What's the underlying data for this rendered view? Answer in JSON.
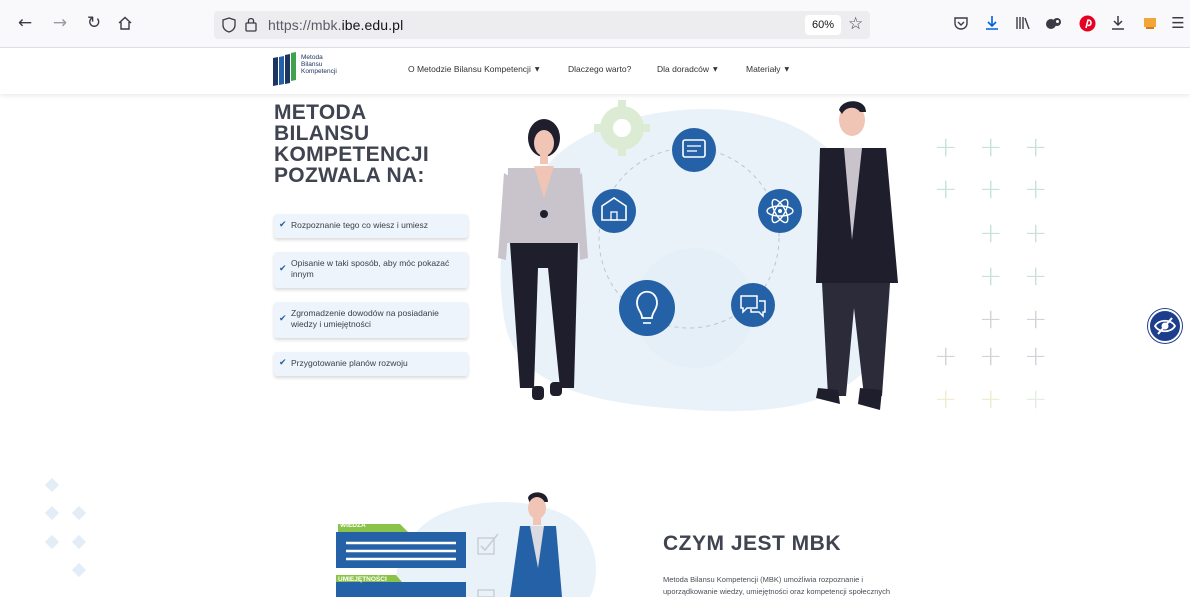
{
  "browser": {
    "url_prefix": "https://mbk.",
    "url_domain": "ibe.edu.pl",
    "zoom": "60%"
  },
  "site": {
    "logo_lines": [
      "Metoda",
      "Bilansu",
      "Kompetencji"
    ],
    "menu": [
      {
        "label": "O Metodzie Bilansu Kompetencji",
        "has_dropdown": true
      },
      {
        "label": "Dlaczego warto?",
        "has_dropdown": false
      },
      {
        "label": "Dla doradców",
        "has_dropdown": true
      },
      {
        "label": "Materiały",
        "has_dropdown": true
      }
    ]
  },
  "hero": {
    "title_lines": [
      "METODA",
      "BILANSU",
      "KOMPETENCJI",
      "POZWALA NA:"
    ],
    "items": [
      "Rozpoznanie tego co wiesz i umiesz",
      "Opisanie w taki sposób, aby móc pokazać innym",
      "Zgromadzenie dowodów na posiadanie wiedzy i umiejętności",
      "Przygotowanie planów rozwoju"
    ]
  },
  "section2": {
    "card_labels": [
      "WIEDZA",
      "UMIEJĘTNOŚCI"
    ],
    "title": "CZYM JEST MBK",
    "text_lines": [
      "Metoda Bilansu Kompetencji (MBK) umożliwia rozpoznanie i",
      "uporządkowanie wiedzy, umiejętności oraz kompetencji społecznych"
    ]
  },
  "colors": {
    "accent_blue": "#2561a6",
    "title_gray": "#3f4450",
    "green": "#8bc34a",
    "plus_green": "#c8e2d8"
  },
  "icons": {
    "hero_circles": [
      "certificate-icon",
      "school-icon",
      "atom-icon",
      "lightbulb-icon",
      "chat-icon"
    ]
  }
}
